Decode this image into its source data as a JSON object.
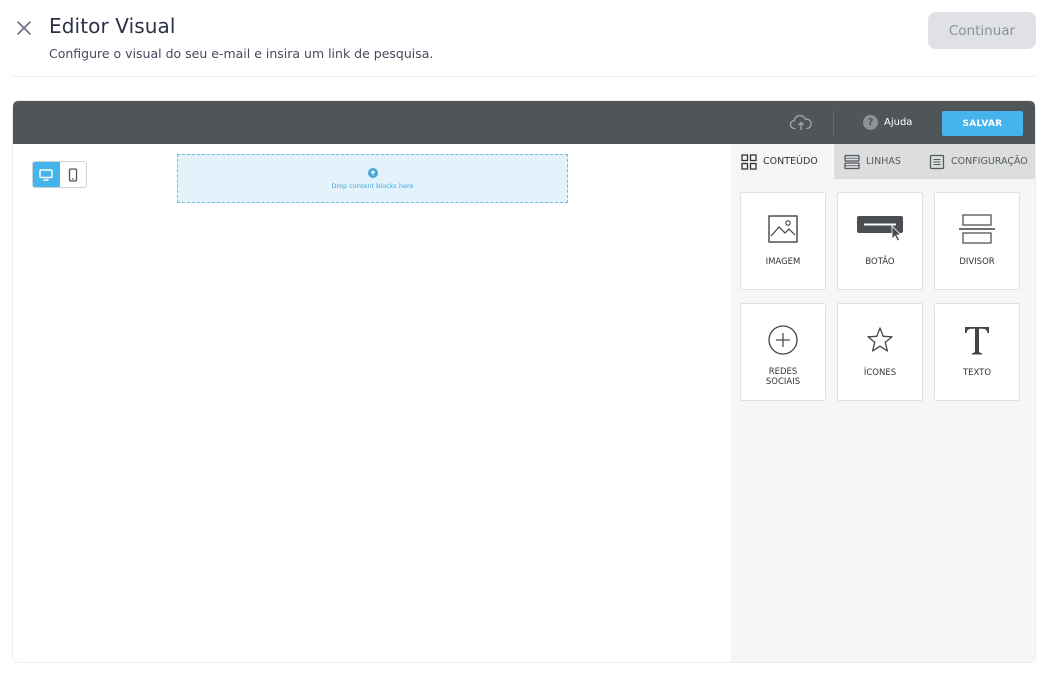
{
  "header": {
    "title": "Editor Visual",
    "subtitle": "Configure o visual do seu e-mail e insira um link de pesquisa.",
    "continue_label": "Continuar"
  },
  "editor": {
    "topbar": {
      "help_label": "Ajuda",
      "save_label": "SALVAR"
    },
    "canvas": {
      "drop_text": "Drop content blocks here",
      "device_mode": "desktop"
    },
    "panel": {
      "tabs": [
        {
          "label": "CONTEÚDO",
          "icon": "grid-icon",
          "active": true
        },
        {
          "label": "LINHAS",
          "icon": "rows-icon",
          "active": false
        },
        {
          "label": "CONFIGURAÇÃO",
          "icon": "settings-doc-icon",
          "active": false
        }
      ],
      "blocks": [
        {
          "label": "IMAGEM",
          "icon": "image-icon"
        },
        {
          "label": "BOTÃO",
          "icon": "button-icon"
        },
        {
          "label": "DIVISOR",
          "icon": "divider-icon"
        },
        {
          "label": "REDES SOCIAIS",
          "icon": "social-plus-icon"
        },
        {
          "label": "ÍCONES",
          "icon": "star-icon"
        },
        {
          "label": "TEXTO",
          "icon": "text-icon"
        }
      ]
    }
  },
  "colors": {
    "accent": "#46b4ec",
    "topbar": "#505557",
    "title": "#2d3148"
  }
}
